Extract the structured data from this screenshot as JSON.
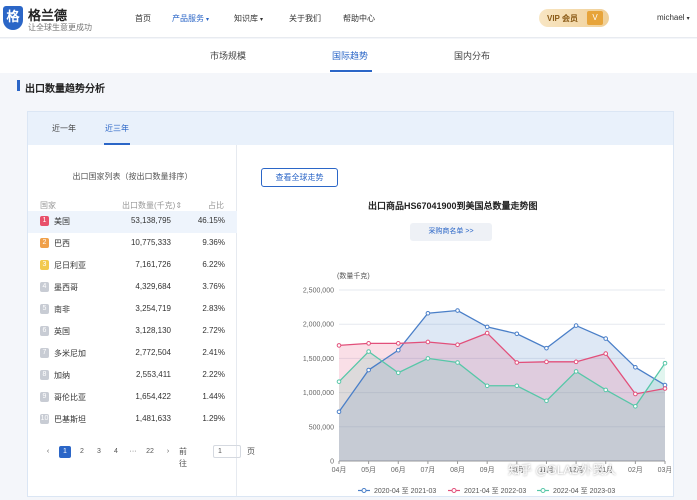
{
  "header": {
    "logo_mark": "格",
    "logo_name": "格兰德",
    "logo_slogan": "让全球生意更成功",
    "nav": [
      {
        "label": "首页",
        "active": false,
        "caret": ""
      },
      {
        "label": "产品服务",
        "active": true,
        "caret": "▾"
      },
      {
        "label": "知识库",
        "active": false,
        "caret": "▾"
      },
      {
        "label": "关于我们",
        "active": false,
        "caret": ""
      },
      {
        "label": "帮助中心",
        "active": false,
        "caret": ""
      }
    ],
    "vip_label": "VIP 会员",
    "vip_icon": "V",
    "user": "michael",
    "user_caret": "▾"
  },
  "subnav": {
    "tabs": [
      {
        "label": "市场规模",
        "active": false
      },
      {
        "label": "国际趋势",
        "active": true
      },
      {
        "label": "国内分布",
        "active": false
      }
    ]
  },
  "section": {
    "title": "出口数量趋势分析"
  },
  "period_tabs": [
    {
      "label": "近一年",
      "active": false
    },
    {
      "label": "近三年",
      "active": true
    }
  ],
  "country_list": {
    "title": "出口国家列表（按出口数量排序）",
    "headers": {
      "country": "国家",
      "quantity": "出口数量(千克)",
      "sort_icon": "⇕",
      "share": "占比"
    },
    "rows": [
      {
        "rank": "1",
        "name": "美国",
        "value": "53,138,795",
        "share": "46.15%"
      },
      {
        "rank": "2",
        "name": "巴西",
        "value": "10,775,333",
        "share": "9.36%"
      },
      {
        "rank": "3",
        "name": "尼日利亚",
        "value": "7,161,726",
        "share": "6.22%"
      },
      {
        "rank": "4",
        "name": "墨西哥",
        "value": "4,329,684",
        "share": "3.76%"
      },
      {
        "rank": "5",
        "name": "南非",
        "value": "3,254,719",
        "share": "2.83%"
      },
      {
        "rank": "6",
        "name": "英国",
        "value": "3,128,130",
        "share": "2.72%"
      },
      {
        "rank": "7",
        "name": "多米尼加",
        "value": "2,772,504",
        "share": "2.41%"
      },
      {
        "rank": "8",
        "name": "加纳",
        "value": "2,553,411",
        "share": "2.22%"
      },
      {
        "rank": "9",
        "name": "哥伦比亚",
        "value": "1,654,422",
        "share": "1.44%"
      },
      {
        "rank": "10",
        "name": "巴基斯坦",
        "value": "1,481,633",
        "share": "1.29%"
      }
    ],
    "rank_colors": [
      "#e8506a",
      "#f0a04a",
      "#f2c94c",
      "#c8ccd4"
    ],
    "pagination": {
      "prev": "‹",
      "pages": [
        "1",
        "2",
        "3",
        "4",
        "···",
        "22"
      ],
      "current": "1",
      "next": "›",
      "goto_prefix": "前往",
      "goto_value": "1",
      "goto_suffix": "页"
    }
  },
  "chart_panel": {
    "view_global_button": "查看全球走势",
    "buyer_list_button": "采购商名单 >>"
  },
  "chart_data": {
    "type": "area",
    "title": "出口商品HS67041900到美国总数量走势图",
    "ylabel": "(数量千克)",
    "xlabel": "",
    "categories": [
      "04月",
      "05月",
      "06月",
      "07月",
      "08月",
      "09月",
      "10月",
      "11月",
      "12月",
      "01月",
      "02月",
      "03月"
    ],
    "ylim": [
      0,
      2500000
    ],
    "yticks": [
      0,
      500000,
      1000000,
      1500000,
      2000000,
      2500000
    ],
    "ytick_labels": [
      "0",
      "500,000",
      "1,000,000",
      "1,500,000",
      "2,000,000",
      "2,500,000"
    ],
    "grid": true,
    "legend_position": "bottom",
    "series": [
      {
        "name": "2020-04 至 2021-03",
        "color": "#4a7fc8",
        "values": [
          720000,
          1330000,
          1620000,
          2160000,
          2200000,
          1960000,
          1860000,
          1650000,
          1980000,
          1790000,
          1370000,
          1110000
        ]
      },
      {
        "name": "2021-04 至 2022-03",
        "color": "#e24f7a",
        "values": [
          1690000,
          1720000,
          1720000,
          1740000,
          1700000,
          1870000,
          1440000,
          1450000,
          1450000,
          1570000,
          980000,
          1060000
        ]
      },
      {
        "name": "2022-04 至 2023-03",
        "color": "#57c7a8",
        "values": [
          1160000,
          1600000,
          1290000,
          1500000,
          1440000,
          1100000,
          1100000,
          880000,
          1310000,
          1040000,
          800000,
          1430000
        ]
      }
    ]
  },
  "watermark": "知乎 @GLAD外贸人"
}
